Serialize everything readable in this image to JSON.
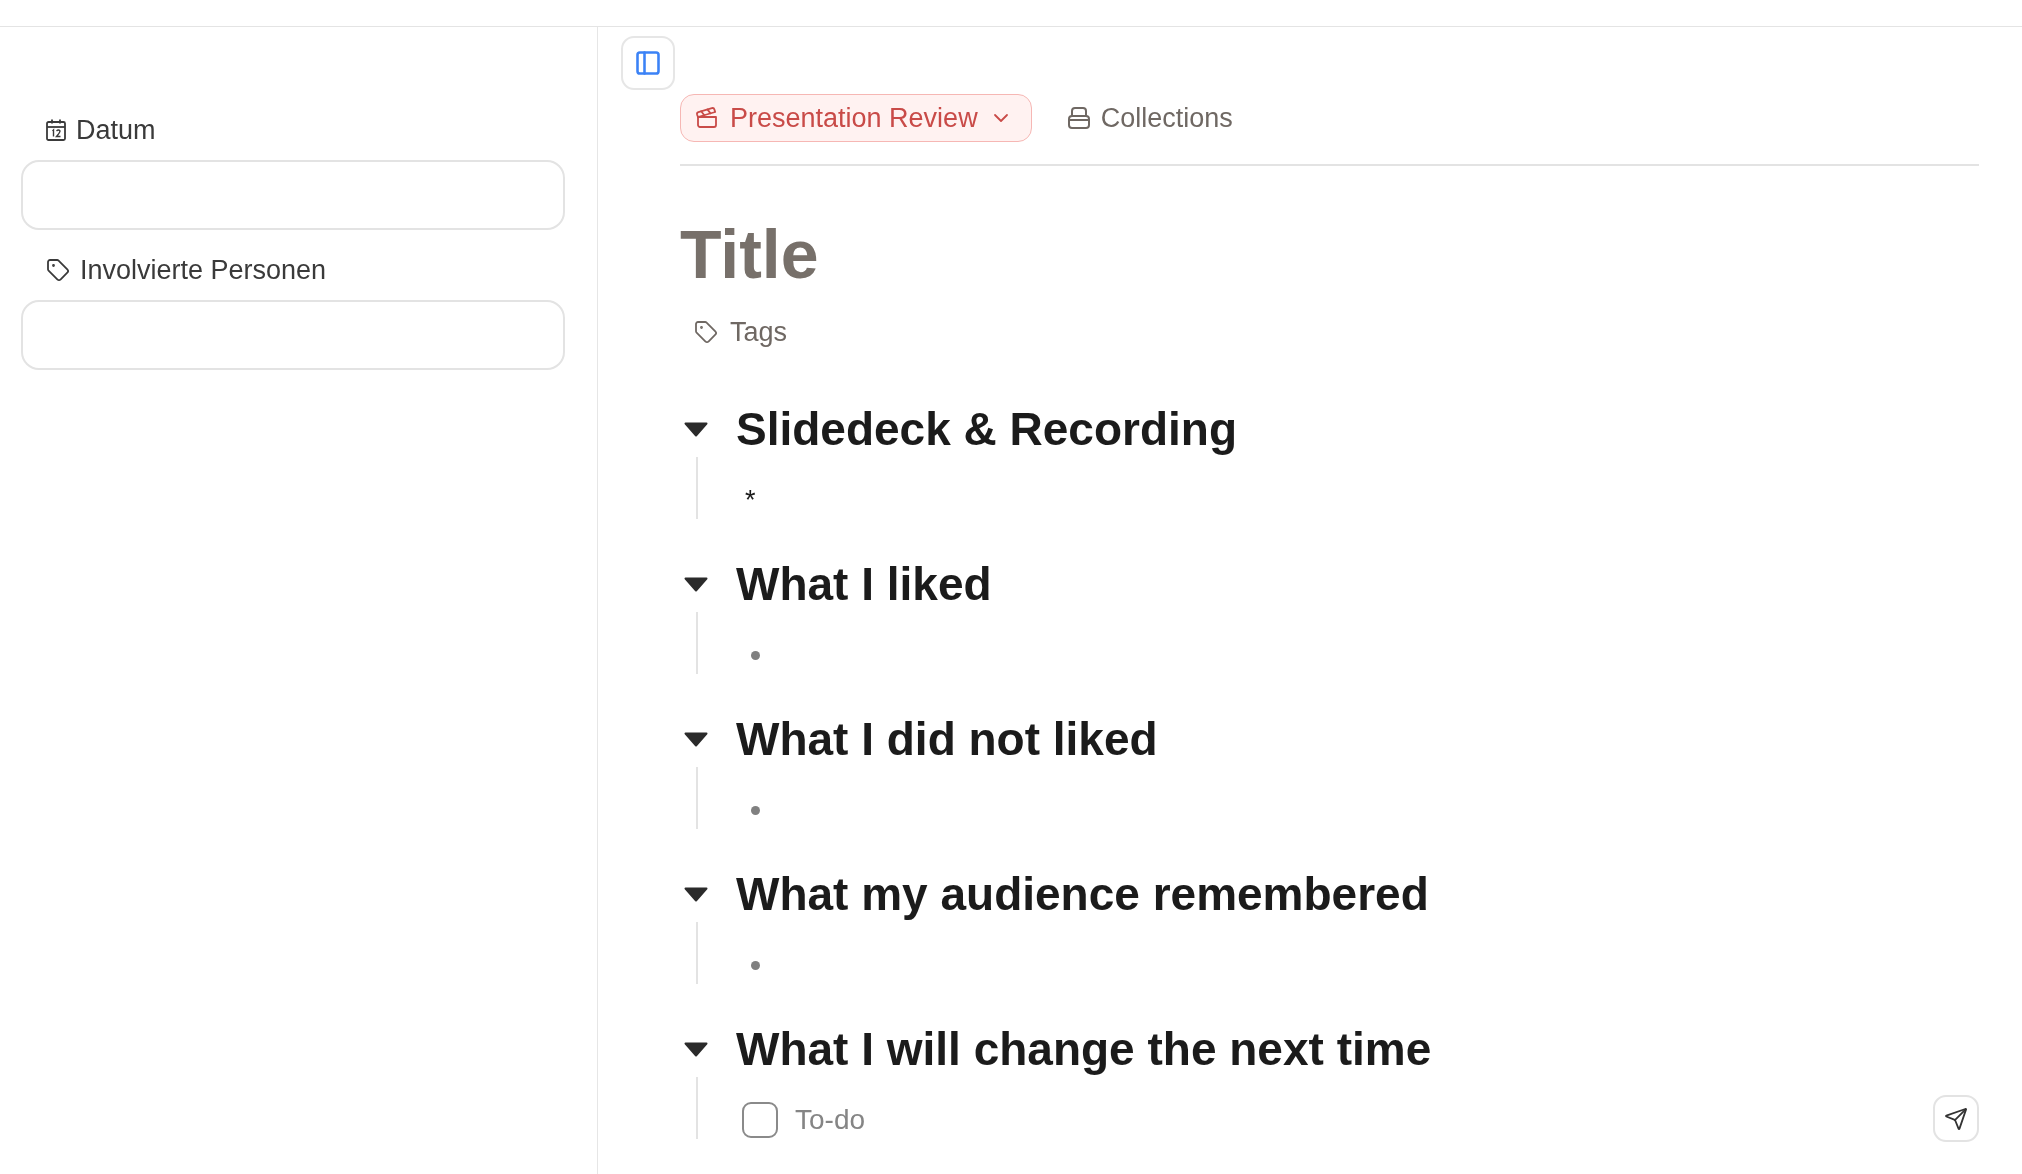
{
  "sidebar": {
    "properties": [
      {
        "kind": "date",
        "label": "Datum"
      },
      {
        "kind": "tag",
        "label": "Involvierte Personen"
      }
    ]
  },
  "toolbar": {
    "template": {
      "label": "Presentation Review"
    },
    "collections": {
      "label": "Collections"
    }
  },
  "title": "Title",
  "tags": {
    "label": "Tags"
  },
  "sections": [
    {
      "heading": "Slidedeck & Recording",
      "expanded": true,
      "content": {
        "kind": "text",
        "text": "*"
      }
    },
    {
      "heading": "What I liked",
      "expanded": true,
      "content": {
        "kind": "bullet"
      }
    },
    {
      "heading": "What I did not liked",
      "expanded": true,
      "content": {
        "kind": "bullet"
      }
    },
    {
      "heading": "What my audience remembered",
      "expanded": true,
      "content": {
        "kind": "bullet"
      }
    },
    {
      "heading": "What I will change the next time",
      "expanded": true,
      "content": {
        "kind": "todo",
        "checked": false,
        "placeholder": "To-do"
      }
    }
  ]
}
